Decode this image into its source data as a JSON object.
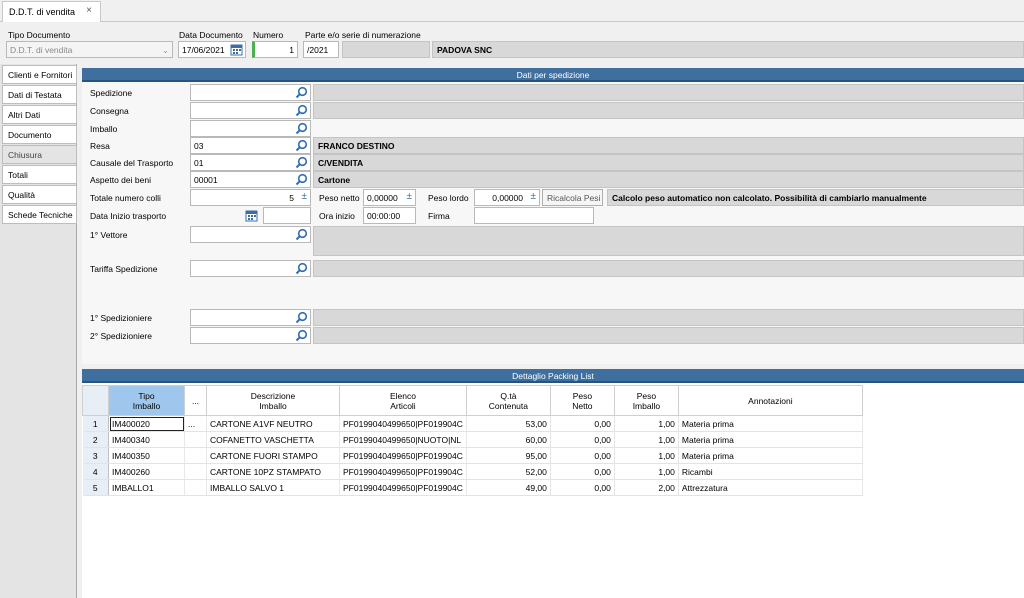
{
  "window": {
    "tab_title": "D.D.T. di vendita",
    "close": "×"
  },
  "header": {
    "tipo_label": "Tipo Documento",
    "tipo_value": "D.D.T. di vendita",
    "data_label": "Data Documento",
    "data_value": "17/06/2021",
    "numero_label": "Numero",
    "numero_value": "1",
    "serie_label": "Parte e/o serie di numerazione",
    "serie_value": "/2021",
    "company": "PADOVA SNC"
  },
  "sidebar": {
    "items": [
      {
        "label": "Clienti e Fornitori"
      },
      {
        "label": "Dati di Testata"
      },
      {
        "label": "Altri Dati"
      },
      {
        "label": "Documento"
      },
      {
        "label": "Chiusura"
      },
      {
        "label": "Totali"
      },
      {
        "label": "Qualità"
      },
      {
        "label": "Schede Tecniche"
      }
    ]
  },
  "spedizione": {
    "title": "Dati per spedizione",
    "spedizione_label": "Spedizione",
    "consegna_label": "Consegna",
    "imballo_label": "Imballo",
    "resa_label": "Resa",
    "resa_code": "03",
    "resa_desc": "FRANCO DESTINO",
    "causale_label": "Causale del Trasporto",
    "causale_code": "01",
    "causale_desc": "C/VENDITA",
    "aspetto_label": "Aspetto dei beni",
    "aspetto_code": "00001",
    "aspetto_desc": "Cartone",
    "colli_label": "Totale numero colli",
    "colli_value": "5",
    "peso_netto_label": "Peso netto",
    "peso_netto_value": "0,00000",
    "peso_lordo_label": "Peso lordo",
    "peso_lordo_value": "0,00000",
    "ricalcola_label": "Ricalcola Pesi",
    "calcolo_msg": "Calcolo peso automatico non calcolato. Possibilità di cambiarlo manualmente",
    "data_inizio_label": "Data Inizio trasporto",
    "ora_label": "Ora inizio",
    "ora_value": "00:00:00",
    "firma_label": "Firma",
    "vettore_label": "1° Vettore",
    "tariffa_label": "Tariffa Spedizione",
    "spedizioniere1_label": "1° Spedizioniere",
    "spedizioniere2_label": "2° Spedizioniere"
  },
  "packing": {
    "title": "Dettaglio Packing List",
    "columns": [
      "Tipo\nImballo",
      "...",
      "Descrizione\nImballo",
      "Elenco\nArticoli",
      "Q.tà\nContenuta",
      "Peso\nNetto",
      "Peso\nImballo",
      "Annotazioni"
    ],
    "ellipsis": "...",
    "rows": [
      {
        "n": "1",
        "tipo": "IM400020",
        "descr": "CARTONE A1VF NEUTRO",
        "elenco": "PF0199040499650|PF019904C",
        "qta": "53,00",
        "netto": "0,00",
        "imballo": "1,00",
        "annot": "Materia prima"
      },
      {
        "n": "2",
        "tipo": "IM400340",
        "descr": "COFANETTO VASCHETTA",
        "elenco": "PF0199040499650|NUOTO|NL",
        "qta": "60,00",
        "netto": "0,00",
        "imballo": "1,00",
        "annot": "Materia prima"
      },
      {
        "n": "3",
        "tipo": "IM400350",
        "descr": "CARTONE FUORI STAMPO",
        "elenco": "PF0199040499650|PF019904C",
        "qta": "95,00",
        "netto": "0,00",
        "imballo": "1,00",
        "annot": "Materia prima"
      },
      {
        "n": "4",
        "tipo": "IM400260",
        "descr": "CARTONE 10PZ STAMPATO",
        "elenco": "PF0199040499650|PF019904C",
        "qta": "52,00",
        "netto": "0,00",
        "imballo": "1,00",
        "annot": "Ricambi"
      },
      {
        "n": "5",
        "tipo": "IMBALLO1",
        "descr": "IMBALLO SALVO 1",
        "elenco": "PF0199040499650|PF019904C",
        "qta": "49,00",
        "netto": "0,00",
        "imballo": "2,00",
        "annot": "Attrezzatura"
      }
    ]
  },
  "colors": {
    "accent": "#3f6f9e",
    "header_selected": "#9fc7ee",
    "lookup_icon": "#2f6db5"
  }
}
